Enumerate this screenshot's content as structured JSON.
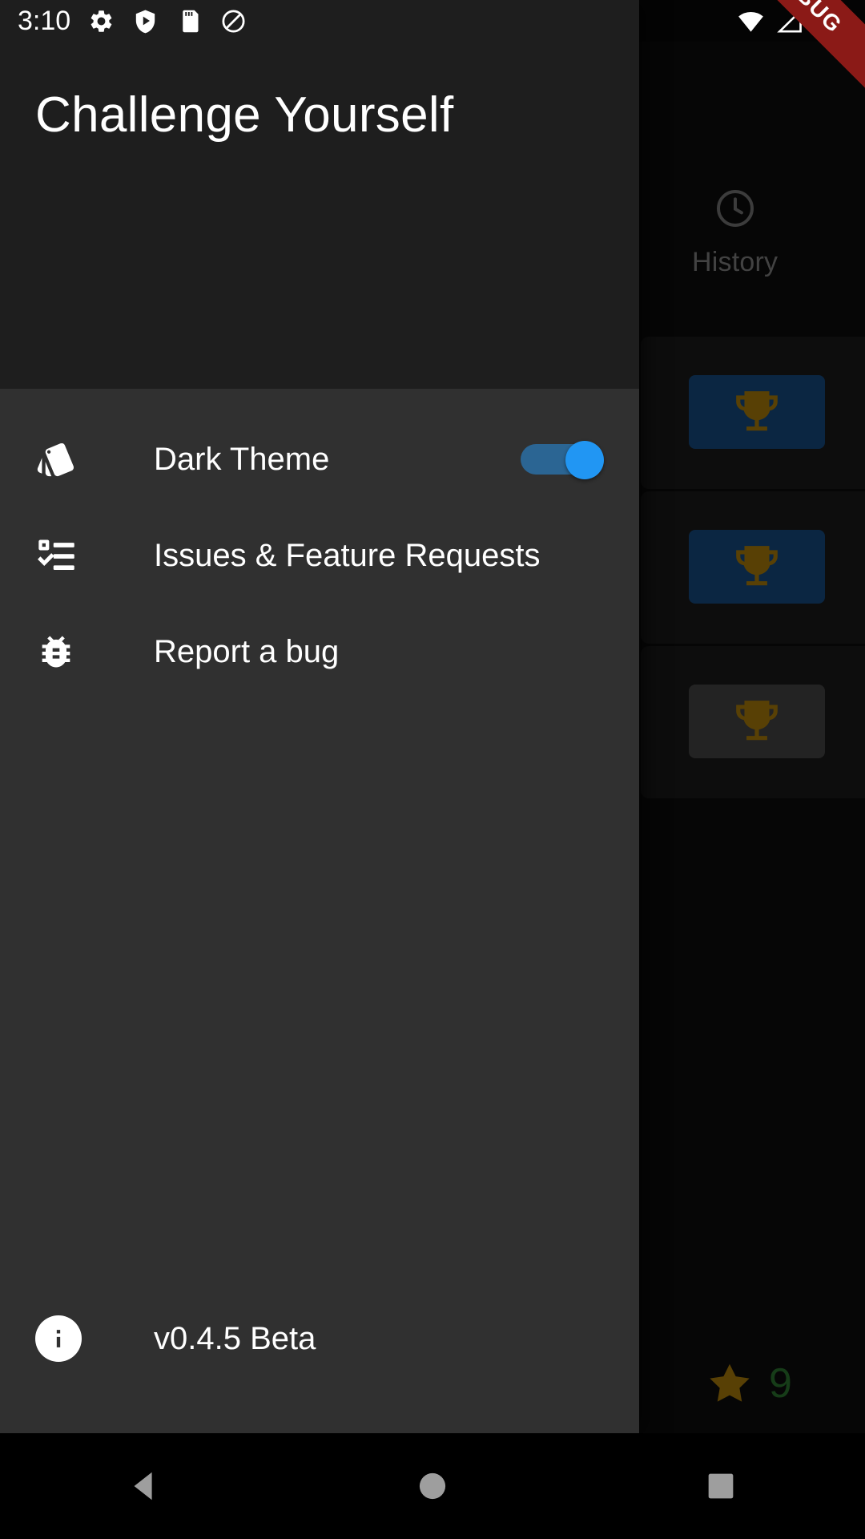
{
  "statusbar": {
    "clock": "3:10",
    "left_icons": [
      "settings-gear-icon",
      "play-protect-shield-icon",
      "sd-card-icon",
      "do-not-disturb-icon"
    ],
    "right_icons": [
      "wifi-icon",
      "cellular-signal-off-icon",
      "battery-full-icon"
    ]
  },
  "debug_ribbon": {
    "label": "DEBUG",
    "color": "#8b1a17"
  },
  "drawer": {
    "title": "Challenge Yourself",
    "items": [
      {
        "label": "Dark Theme",
        "icon": "style-swatches-icon",
        "control": "switch",
        "switch_on": true
      },
      {
        "label": "Issues & Feature Requests",
        "icon": "task-list-check-icon",
        "control": "none"
      },
      {
        "label": "Report a bug",
        "icon": "bug-report-icon",
        "control": "none"
      }
    ],
    "footer": {
      "label": "v0.4.5 Beta",
      "icon": "info-circle-icon"
    }
  },
  "background_app": {
    "tab": {
      "label": "History",
      "icon": "clock-history-icon"
    },
    "cards": [
      {
        "thumb_color": "#17518a",
        "icon": "trophy-icon"
      },
      {
        "thumb_color": "#17518a",
        "icon": "trophy-icon"
      },
      {
        "thumb_color": "#4a4a4a",
        "icon": "trophy-icon"
      }
    ],
    "score": {
      "icon": "star-icon",
      "value": "9",
      "star_color": "#b8860b",
      "value_color": "#2e7d32"
    }
  },
  "navbar": {
    "buttons": [
      {
        "name": "back-button",
        "icon": "triangle-back-icon"
      },
      {
        "name": "home-button",
        "icon": "circle-home-icon"
      },
      {
        "name": "recents-button",
        "icon": "square-recents-icon"
      }
    ]
  },
  "colors": {
    "drawer_bg": "#303030",
    "drawer_header_bg": "#1e1e1e",
    "accent_blue": "#2196f3",
    "track_blue": "#2b6593",
    "gold": "#b8860b",
    "green": "#2e7d32"
  }
}
